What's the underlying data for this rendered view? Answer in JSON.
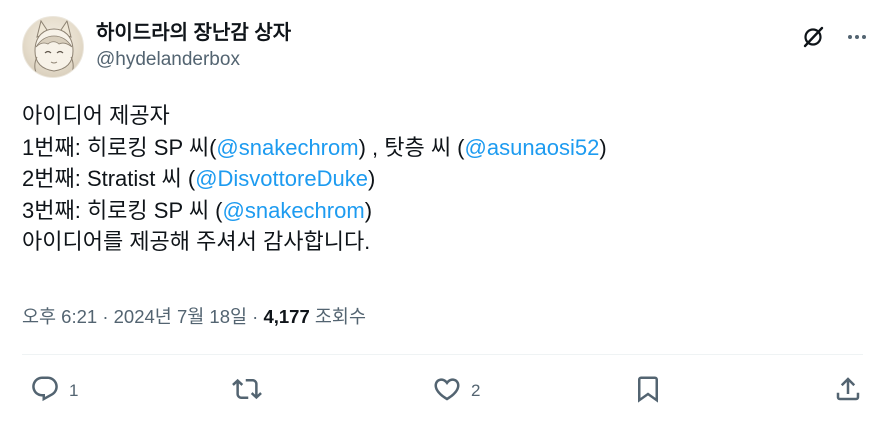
{
  "author": {
    "display_name": "하이드라의 장난감 상자",
    "handle": "@hydelanderbox"
  },
  "tweet": {
    "lines": [
      [
        {
          "text": "아이디어 제공자",
          "mention": false
        }
      ],
      [
        {
          "text": "1번째: 히로킹 SP 씨(",
          "mention": false
        },
        {
          "text": "@snakechrom",
          "mention": true
        },
        {
          "text": ") , 탓층 씨 (",
          "mention": false
        },
        {
          "text": "@asunaosi52",
          "mention": true
        },
        {
          "text": ")",
          "mention": false
        }
      ],
      [
        {
          "text": "2번째: Stratist 씨 (",
          "mention": false
        },
        {
          "text": "@DisvottoreDuke",
          "mention": true
        },
        {
          "text": ")",
          "mention": false
        }
      ],
      [
        {
          "text": "3번째: 히로킹 SP 씨 (",
          "mention": false
        },
        {
          "text": "@snakechrom",
          "mention": true
        },
        {
          "text": ")",
          "mention": false
        }
      ],
      [
        {
          "text": "아이디어를 제공해 주셔서 감사합니다.",
          "mention": false
        }
      ]
    ]
  },
  "meta": {
    "time": "오후 6:21",
    "separator": " · ",
    "date": "2024년 7월 18일",
    "views_count": "4,177",
    "views_label": "조회수"
  },
  "actions": {
    "reply_count": "1",
    "like_count": "2"
  },
  "icons": {
    "grok": "grok-icon",
    "more": "more-icon",
    "reply": "reply-icon",
    "retweet": "retweet-icon",
    "like": "like-icon",
    "bookmark": "bookmark-icon",
    "share": "share-icon"
  },
  "colors": {
    "text": "#0f1419",
    "secondary": "#536471",
    "mention": "#1d9bf0",
    "divider": "#eff3f4"
  }
}
